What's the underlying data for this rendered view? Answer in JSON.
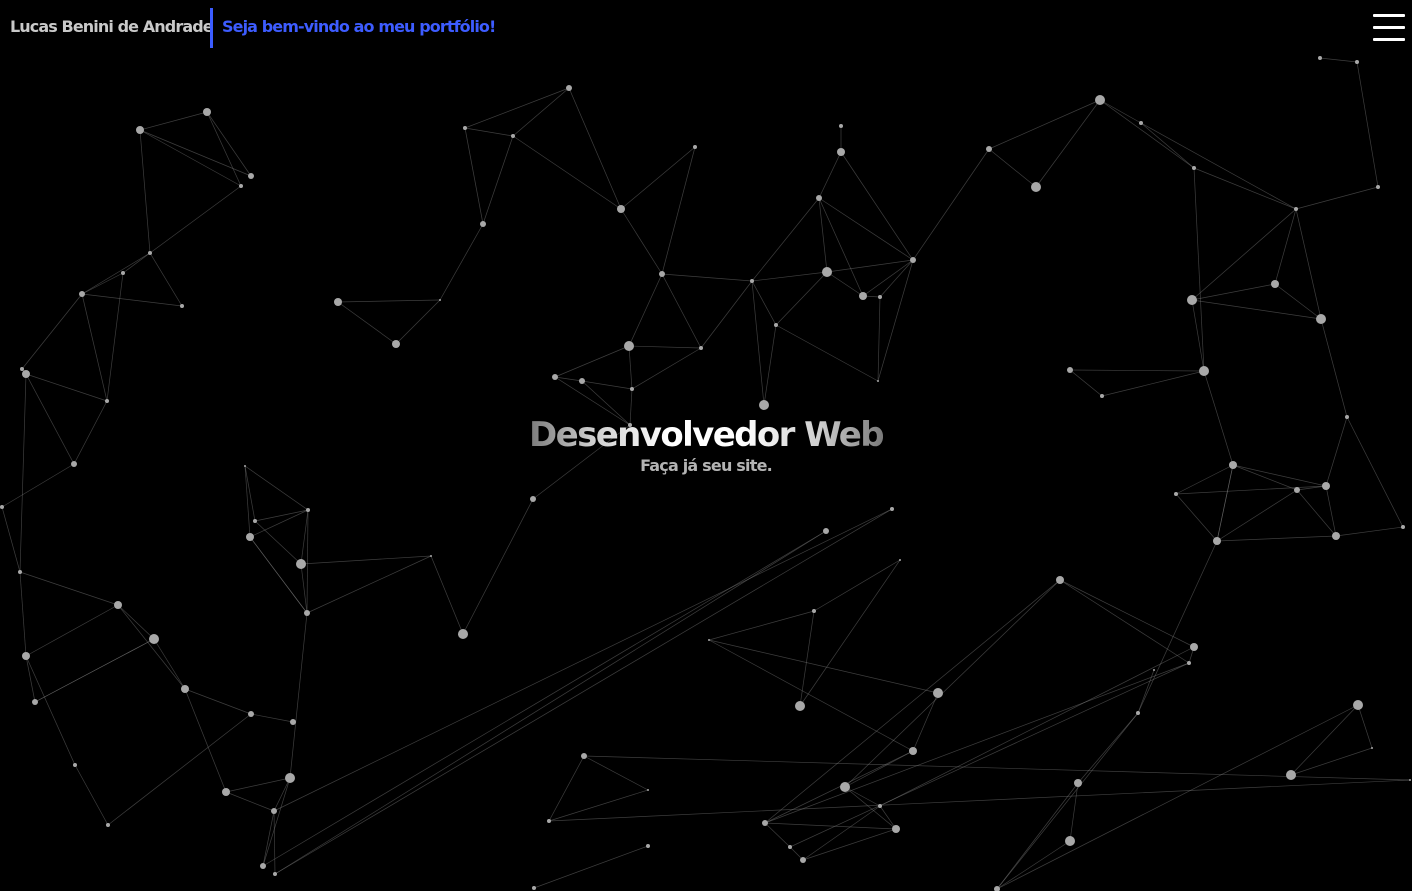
{
  "header": {
    "name": "Lucas Benini de Andrade",
    "welcome": "Seja bem-vindo ao meu portfólio!",
    "menu_icon": "hamburger-menu-icon"
  },
  "hero": {
    "title": "Desenvolvedor Web",
    "subtitle": "Faça já seu site."
  },
  "colors": {
    "background": "#000000",
    "accent": "#3d5cff",
    "name_text": "#c9c9c9",
    "network": "#a8a8a8"
  }
}
